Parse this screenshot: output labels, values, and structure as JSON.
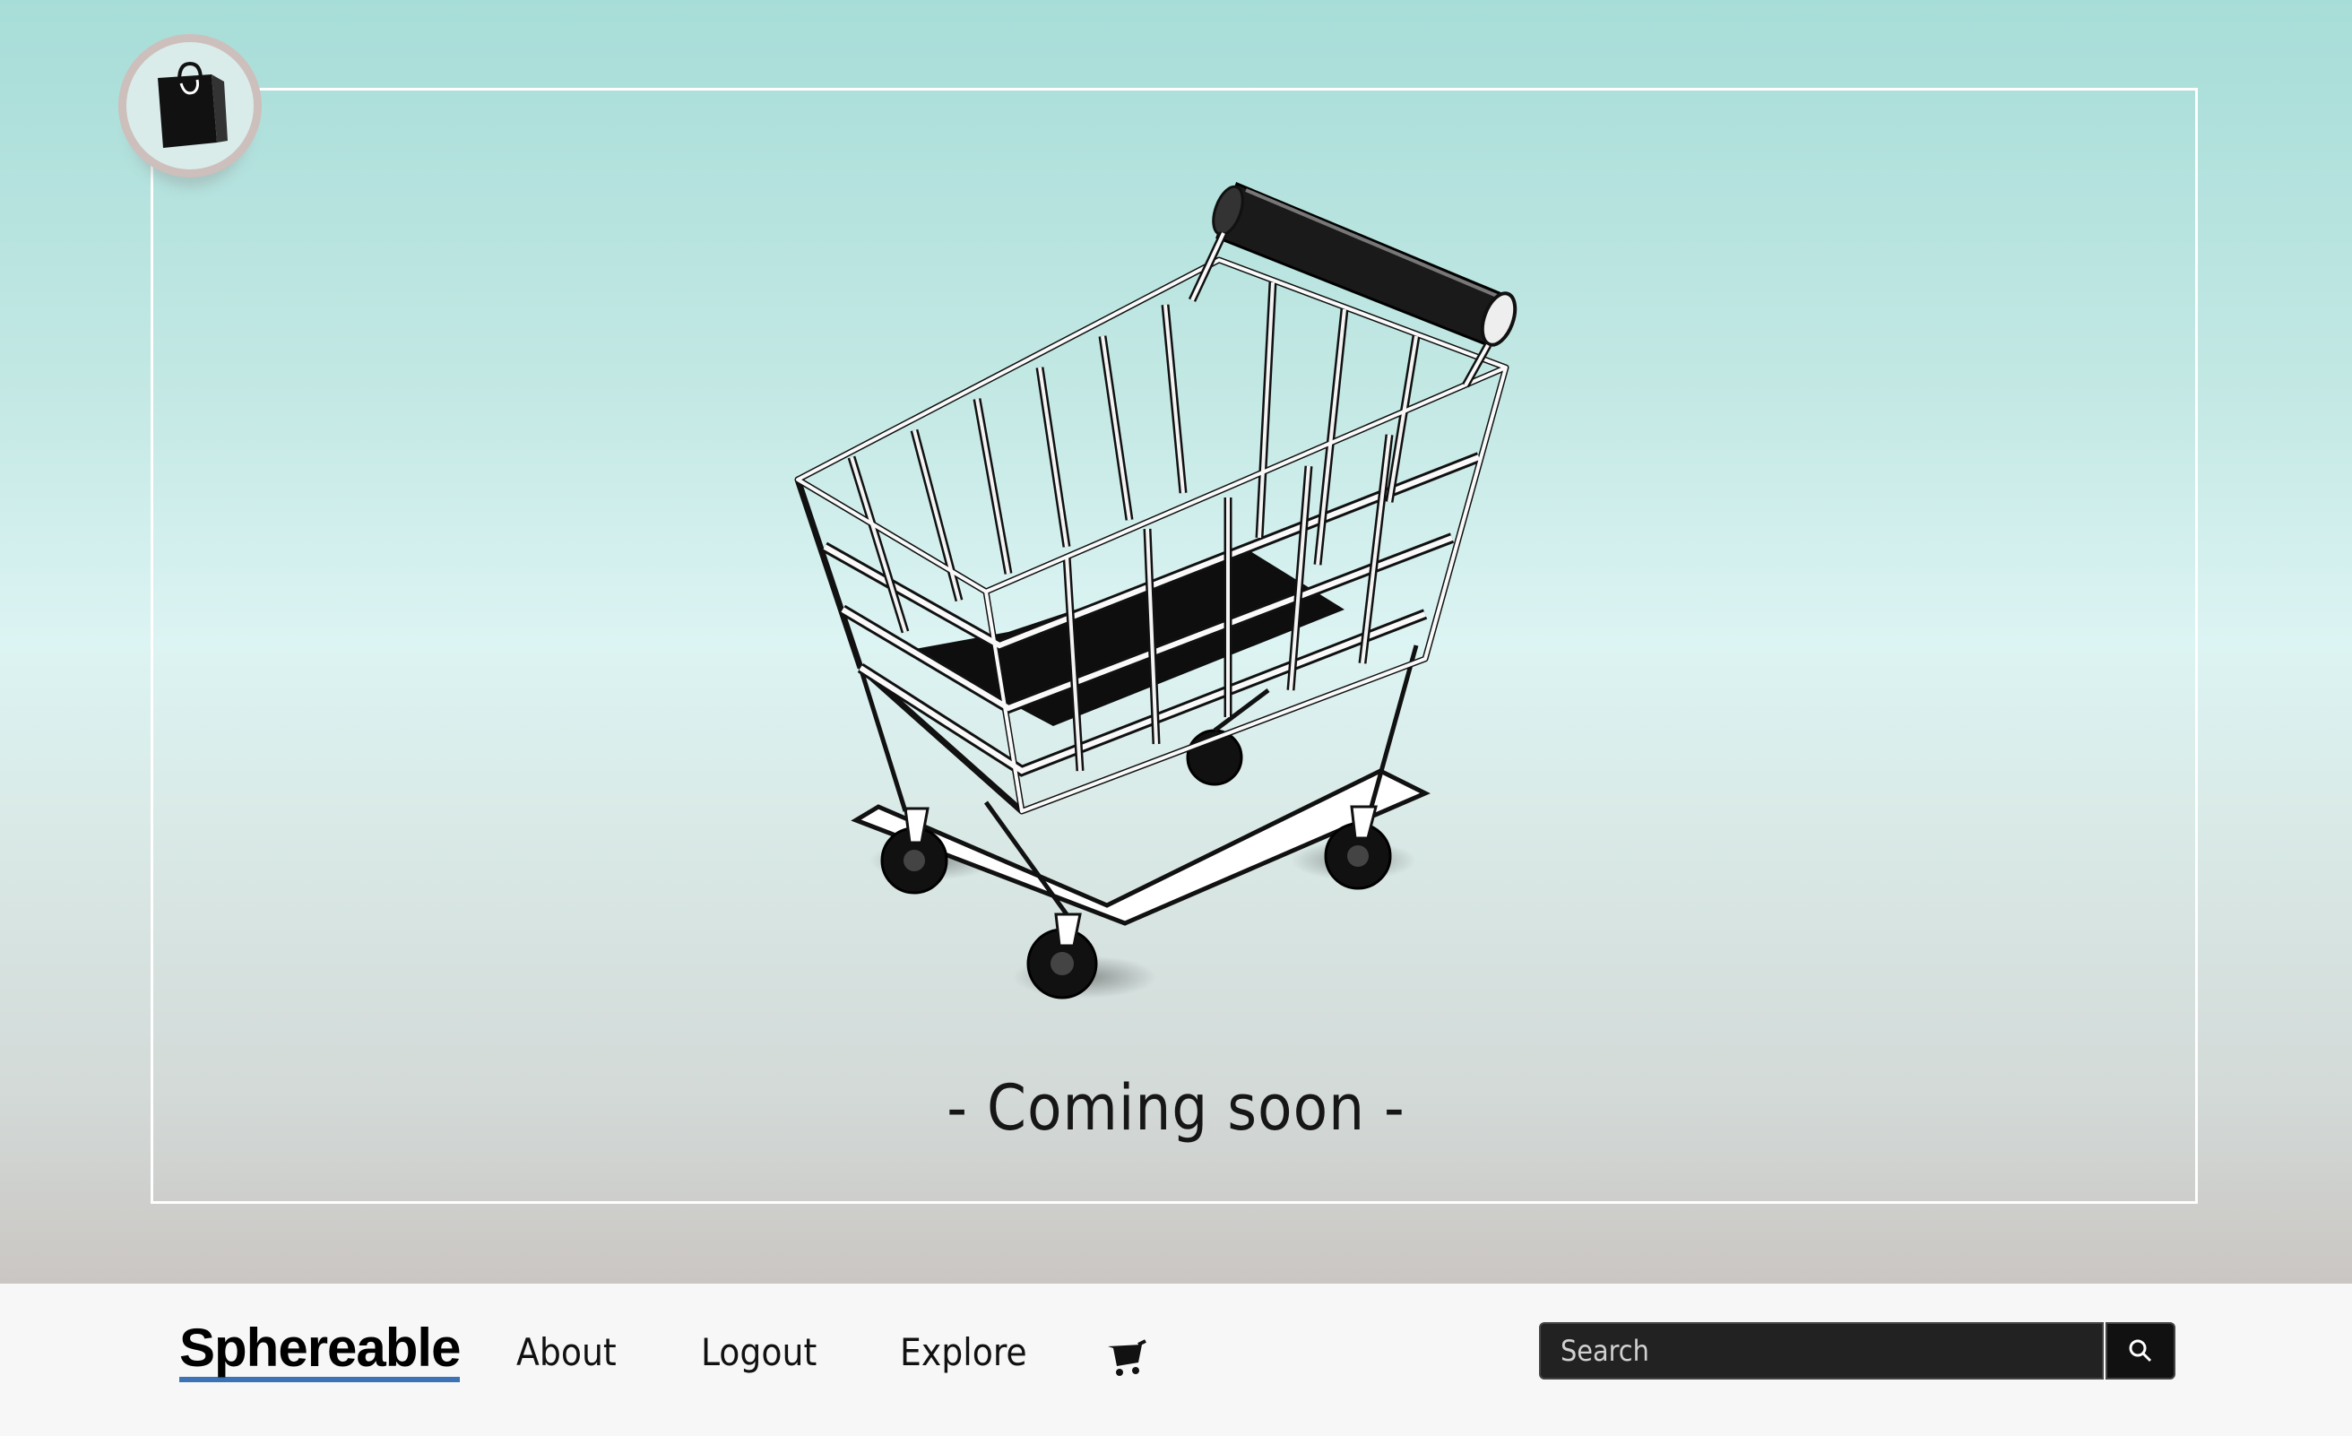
{
  "hero": {
    "message": "- Coming soon -",
    "logo_icon": "shopping-bag-icon",
    "illustration": "shopping-cart-illustration"
  },
  "nav": {
    "brand": "Sphereable",
    "links": [
      {
        "label": "About"
      },
      {
        "label": "Logout"
      },
      {
        "label": "Explore"
      }
    ],
    "cart_icon": "cart-icon"
  },
  "search": {
    "placeholder": "Search",
    "button_icon": "search-icon"
  },
  "colors": {
    "accent_underline": "#3d72b4",
    "search_background": "#222222",
    "navbar_background": "#f7f7f7"
  }
}
